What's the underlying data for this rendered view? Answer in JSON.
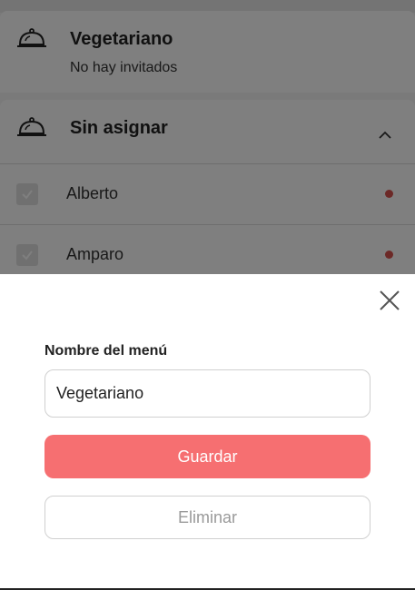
{
  "colors": {
    "primary": "#f66f71",
    "status_dot": "#d9534f",
    "overlay": "rgba(0,0,0,0.5)"
  },
  "background_list": {
    "sections": [
      {
        "icon": "food-cloche-icon",
        "title": "Vegetariano",
        "subtitle": "No hay invitados"
      },
      {
        "icon": "food-cloche-icon",
        "title": "Sin asignar",
        "expanded": true
      }
    ],
    "guests": [
      {
        "name": "Alberto",
        "checked": true,
        "status": "red-dot"
      },
      {
        "name": "Amparo",
        "checked": true,
        "status": "red-dot"
      }
    ]
  },
  "sheet": {
    "close_icon": "close-icon",
    "field_label": "Nombre del menú",
    "input_value": "Vegetariano",
    "save_label": "Guardar",
    "delete_label": "Eliminar"
  }
}
